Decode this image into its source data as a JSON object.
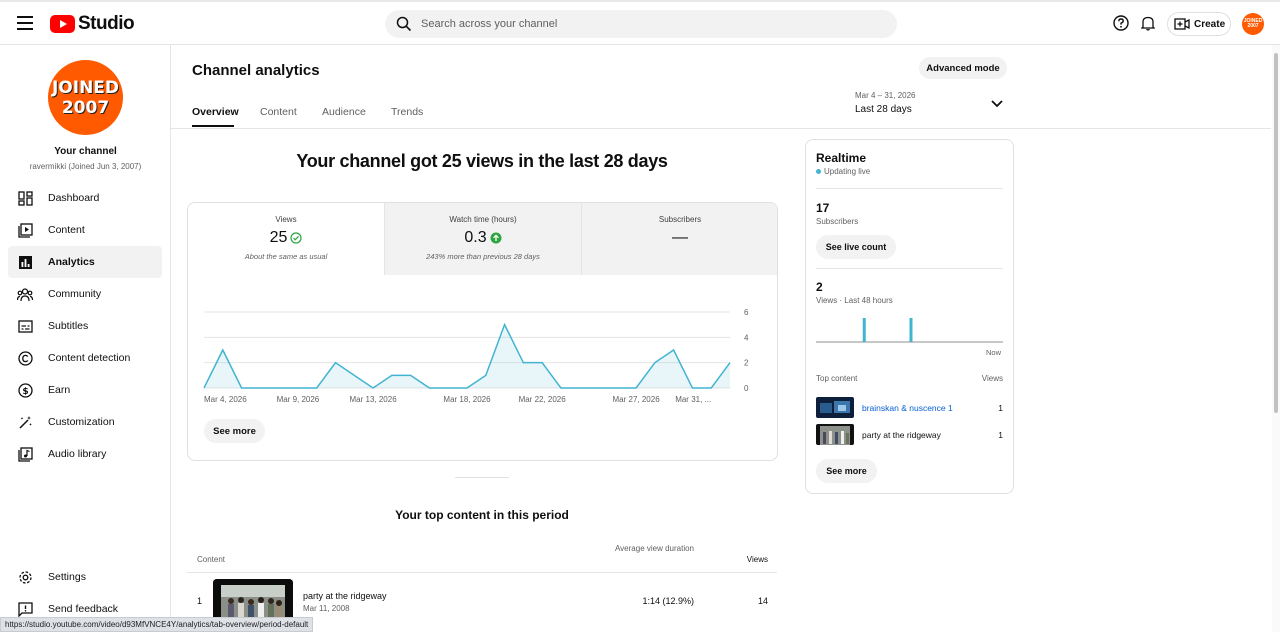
{
  "app": {
    "brand": "Studio",
    "search_placeholder": "Search across your channel",
    "create_label": "Create",
    "avatar_text": "JOINED 2007"
  },
  "sidebar": {
    "avatar_line1": "JOINED",
    "avatar_line2": "2007",
    "title": "Your channel",
    "subtitle": "ravermikki (Joined Jun 3, 2007)",
    "items": [
      {
        "label": "Dashboard",
        "icon": "dashboard-icon"
      },
      {
        "label": "Content",
        "icon": "content-icon"
      },
      {
        "label": "Analytics",
        "icon": "analytics-icon",
        "active": true
      },
      {
        "label": "Community",
        "icon": "community-icon"
      },
      {
        "label": "Subtitles",
        "icon": "subtitles-icon"
      },
      {
        "label": "Content detection",
        "icon": "copyright-icon"
      },
      {
        "label": "Earn",
        "icon": "dollar-icon"
      },
      {
        "label": "Customization",
        "icon": "magic-wand-icon"
      },
      {
        "label": "Audio library",
        "icon": "audio-library-icon"
      }
    ],
    "footer": [
      {
        "label": "Settings",
        "icon": "gear-icon"
      },
      {
        "label": "Send feedback",
        "icon": "feedback-icon"
      }
    ]
  },
  "header": {
    "title": "Channel analytics",
    "advanced_mode": "Advanced mode",
    "tabs": [
      "Overview",
      "Content",
      "Audience",
      "Trends"
    ],
    "active_tab": "Overview",
    "date_range": "Mar 4 – 31, 2026",
    "period": "Last 28 days"
  },
  "summary": {
    "headline": "Your channel got 25 views in the last 28 days",
    "metrics": [
      {
        "label": "Views",
        "value": "25",
        "note": "About the same as usual",
        "status": "same"
      },
      {
        "label": "Watch time (hours)",
        "value": "0.3",
        "note": "243% more than previous 28 days",
        "status": "up"
      },
      {
        "label": "Subscribers",
        "value": "—",
        "note": "",
        "status": "none"
      }
    ],
    "see_more": "See more"
  },
  "chart_data": {
    "type": "area",
    "x": [
      "Mar 4, 2026",
      "Mar 5, 2026",
      "Mar 6, 2026",
      "Mar 7, 2026",
      "Mar 8, 2026",
      "Mar 9, 2026",
      "Mar 10, 2026",
      "Mar 11, 2026",
      "Mar 12, 2026",
      "Mar 13, 2026",
      "Mar 14, 2026",
      "Mar 15, 2026",
      "Mar 16, 2026",
      "Mar 17, 2026",
      "Mar 18, 2026",
      "Mar 19, 2026",
      "Mar 20, 2026",
      "Mar 21, 2026",
      "Mar 22, 2026",
      "Mar 23, 2026",
      "Mar 24, 2026",
      "Mar 25, 2026",
      "Mar 26, 2026",
      "Mar 27, 2026",
      "Mar 28, 2026",
      "Mar 29, 2026",
      "Mar 30, 2026",
      "Mar 31, 2026"
    ],
    "values": [
      0,
      3,
      0,
      0,
      0,
      0,
      0,
      2,
      1,
      0,
      1,
      1,
      0,
      0,
      0,
      1,
      5,
      2,
      2,
      0,
      0,
      0,
      0,
      0,
      2,
      3,
      0,
      0,
      2
    ],
    "x_tick_labels": [
      "Mar 4, 2026",
      "Mar 9, 2026",
      "Mar 13, 2026",
      "Mar 18, 2026",
      "Mar 22, 2026",
      "Mar 27, 2026",
      "Mar 31, ..."
    ],
    "x_tick_index": [
      0,
      5,
      9,
      14,
      18,
      23,
      27
    ],
    "y_ticks": [
      0,
      2,
      4,
      6
    ],
    "ylim": [
      0,
      6
    ],
    "grid": true,
    "color": "#41b4d2"
  },
  "top_content": {
    "title": "Your top content in this period",
    "headers": {
      "content": "Content",
      "avg_duration": "Average view duration",
      "views": "Views"
    },
    "rows": [
      {
        "rank": "1",
        "title": "party at the ridgeway",
        "date": "Mar 11, 2008",
        "duration": "1:14  (12.9%)",
        "views": "14"
      }
    ]
  },
  "realtime": {
    "title": "Realtime",
    "status": "Updating live",
    "subscribers_value": "17",
    "subscribers_label": "Subscribers",
    "live_count_button": "See live count",
    "views_value": "2",
    "views_label": "Views · Last 48 hours",
    "now_label": "Now",
    "bars": [
      {
        "hours_ago": 36,
        "views": 1
      },
      {
        "hours_ago": 24,
        "views": 1
      }
    ],
    "top_content_label": "Top content",
    "views_header": "Views",
    "items": [
      {
        "title": "brainskan & nuscence 1",
        "views": "1",
        "link": true
      },
      {
        "title": "party at the ridgeway",
        "views": "1",
        "link": false
      }
    ],
    "see_more": "See more"
  },
  "status_bar": {
    "url": "https://studio.youtube.com/video/d93MfVNCE4Y/analytics/tab-overview/period-default"
  }
}
